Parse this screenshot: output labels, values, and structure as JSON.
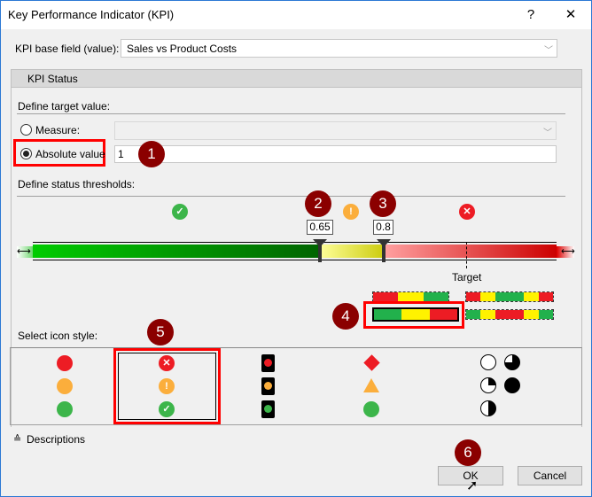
{
  "window": {
    "title": "Key Performance Indicator (KPI)",
    "help": "?",
    "close": "✕"
  },
  "base_field": {
    "label": "KPI base field (value):",
    "value": "Sales vs Product Costs"
  },
  "tab": {
    "label": "KPI Status"
  },
  "target": {
    "heading": "Define target value:",
    "measure_label": "Measure:",
    "measure_value": "",
    "absolute_label": "Absolute value",
    "absolute_value": "1",
    "selected": "absolute"
  },
  "thresholds": {
    "heading": "Define status thresholds:",
    "low": "0.65",
    "high": "0.8",
    "target_label": "Target"
  },
  "icon_style": {
    "heading": "Select icon style:",
    "selected_index": 1
  },
  "descriptions": {
    "label": "Descriptions"
  },
  "buttons": {
    "ok": "OK",
    "cancel": "Cancel"
  },
  "callouts": [
    "1",
    "2",
    "3",
    "4",
    "5",
    "6"
  ],
  "colors": {
    "red": "#ed1c24",
    "yellow": "#fff200",
    "green": "#22b14c",
    "orange": "#fbae3c",
    "callout": "#8b0000"
  }
}
